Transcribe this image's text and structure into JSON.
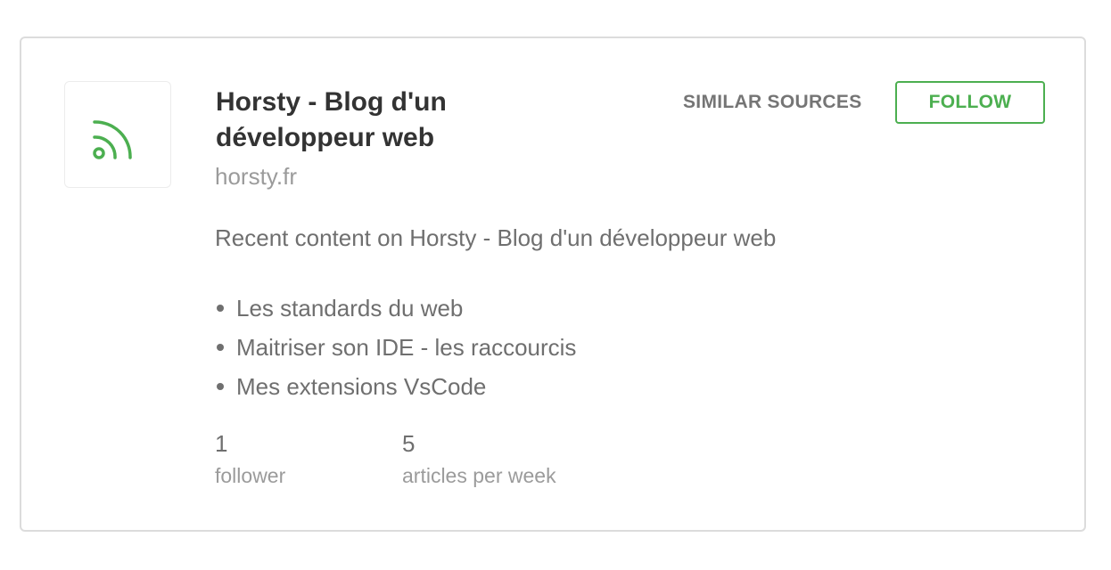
{
  "source": {
    "title": "Horsty - Blog d'un développeur web",
    "domain": "horsty.fr",
    "icon": "rss-feed-icon",
    "description": "Recent content on Horsty - Blog d'un développeur web"
  },
  "actions": {
    "similar_label": "SIMILAR SOURCES",
    "follow_label": "FOLLOW"
  },
  "recent_articles": [
    "Les standards du web",
    "Maitriser son IDE - les raccourcis",
    "Mes extensions VsCode"
  ],
  "stats": {
    "followers": {
      "value": "1",
      "label": "follower"
    },
    "articles": {
      "value": "5",
      "label": "articles per week"
    }
  },
  "colors": {
    "accent": "#4caf50",
    "title": "#333333",
    "text": "#6f6f6f",
    "muted": "#9b9b9b",
    "border": "#dcdcdc"
  }
}
